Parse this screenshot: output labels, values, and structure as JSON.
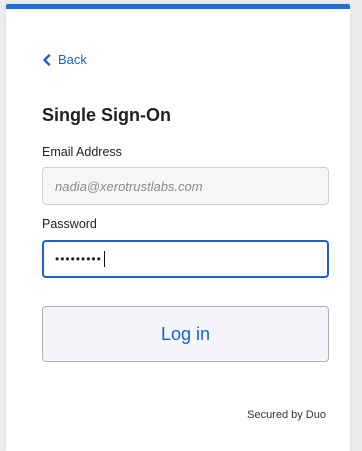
{
  "back": {
    "label": "Back"
  },
  "title": "Single Sign-On",
  "email": {
    "label": "Email Address",
    "value": "nadia@xerotrustlabs.com"
  },
  "password": {
    "label": "Password",
    "masked_value": "•••••••••"
  },
  "login": {
    "label": "Log in"
  },
  "footer": {
    "secured_by": "Secured by Duo"
  },
  "colors": {
    "accent": "#1d6fd6",
    "link": "#1a5fcf"
  },
  "icons": {
    "back": "chevron-left-icon"
  }
}
